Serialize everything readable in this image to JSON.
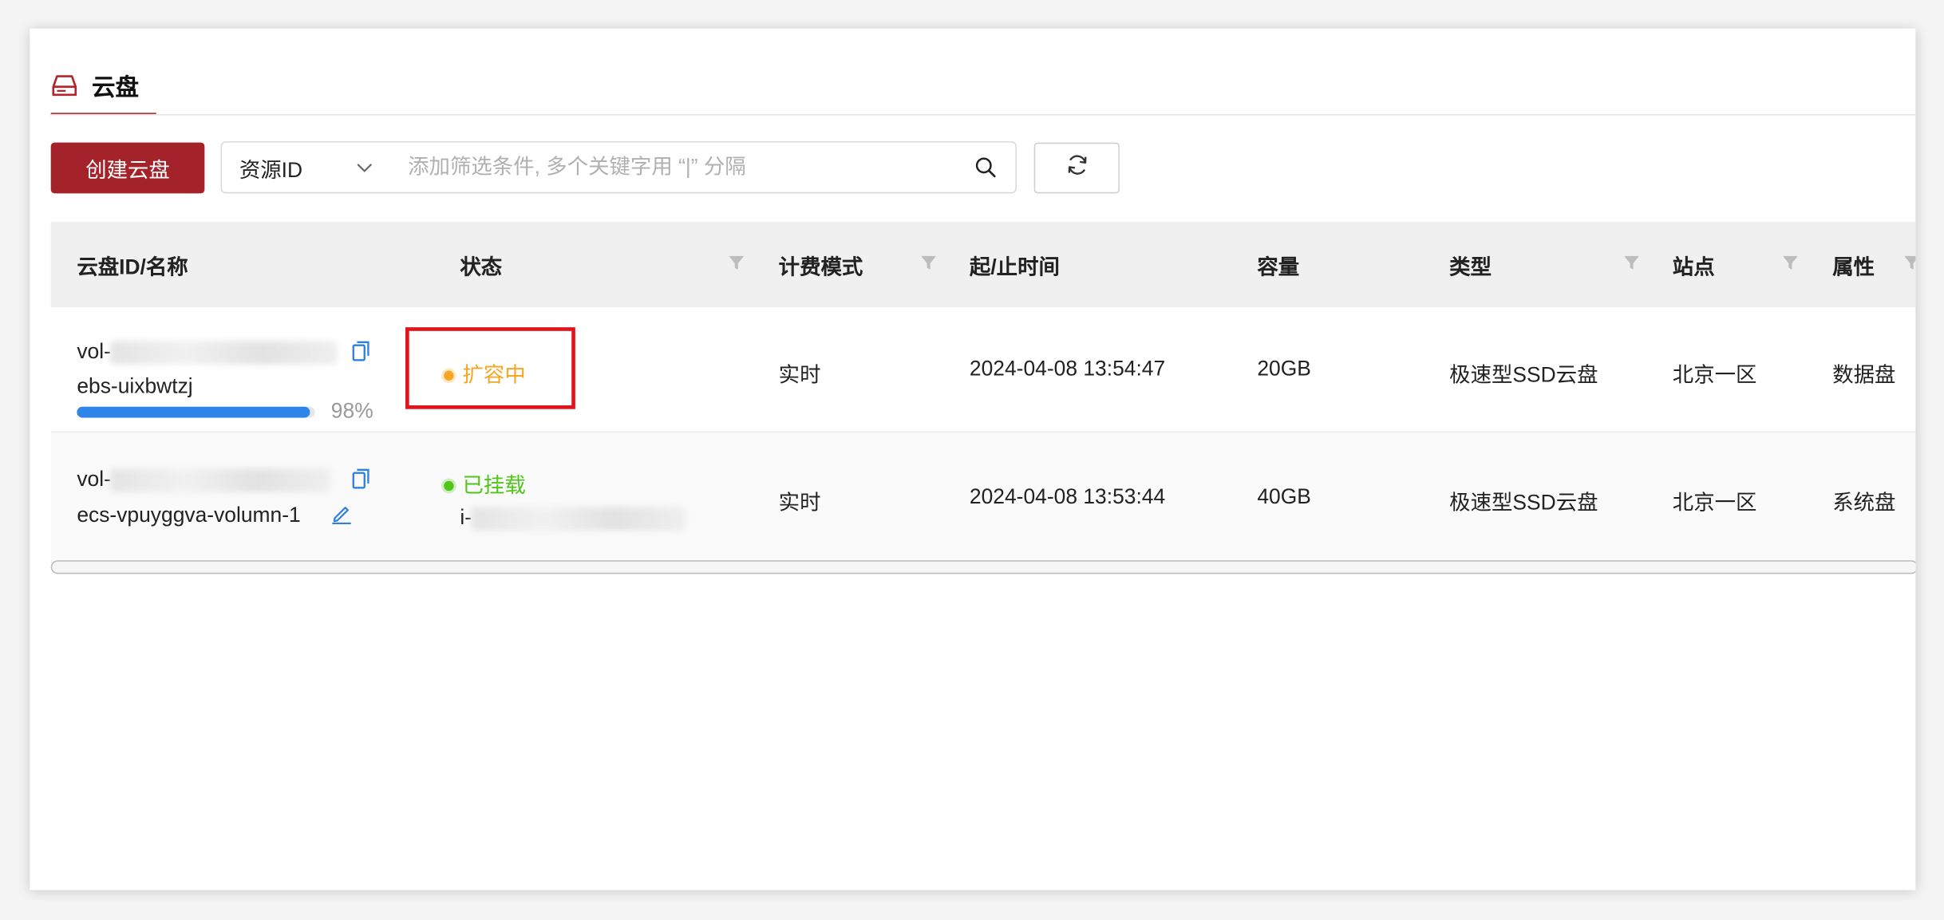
{
  "tab": {
    "title": "云盘",
    "icon": "cloud-disk-icon"
  },
  "toolbar": {
    "create_label": "创建云盘",
    "search_field": "资源ID",
    "search_placeholder": "添加筛选条件, 多个关键字用 “|” 分隔",
    "search_icon": "search-icon",
    "refresh_icon": "refresh-icon"
  },
  "columns": [
    {
      "label": "云盘ID/名称",
      "filter": false
    },
    {
      "label": "状态",
      "filter": true
    },
    {
      "label": "计费模式",
      "filter": true
    },
    {
      "label": "起/止时间",
      "filter": false
    },
    {
      "label": "容量",
      "filter": false
    },
    {
      "label": "类型",
      "filter": true
    },
    {
      "label": "站点",
      "filter": true
    },
    {
      "label": "属性",
      "filter": true
    }
  ],
  "rows": [
    {
      "id_prefix": "vol-",
      "name": "ebs-uixbwtzj",
      "progress_percent": 98,
      "progress_text": "98%",
      "status": "扩容中",
      "status_color": "#f5a623",
      "billing": "实时",
      "time": "2024-04-08 13:54:47",
      "capacity": "20GB",
      "type": "极速型SSD云盘",
      "site": "北京一区",
      "attribute": "数据盘"
    },
    {
      "id_prefix": "vol-",
      "name": "ecs-vpuyggva-volumn-1",
      "status": "已挂载",
      "status_color": "#52c41a",
      "instance_prefix": "i-",
      "billing": "实时",
      "time": "2024-04-08 13:53:44",
      "capacity": "40GB",
      "type": "极速型SSD云盘",
      "site": "北京一区",
      "attribute": "系统盘"
    }
  ],
  "colors": {
    "brand": "#a4222a",
    "highlight": "#e0151c",
    "link": "#2f7fe0",
    "progress": "#2f86e8"
  }
}
